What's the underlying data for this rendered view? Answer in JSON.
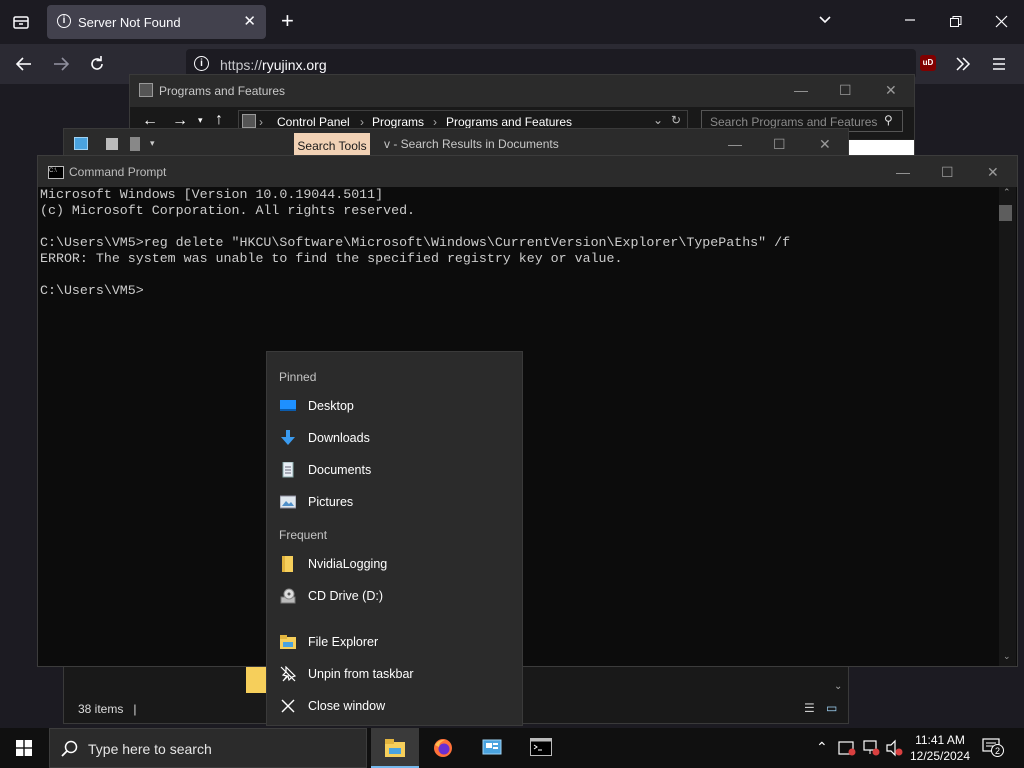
{
  "browser": {
    "tab_title": "Server Not Found",
    "url_prefix": "https://",
    "url_domain": "ryujinx.org",
    "ublock_badge": "uD"
  },
  "programs_window": {
    "title": "Programs and Features",
    "breadcrumb": [
      "Control Panel",
      "Programs",
      "Programs and Features"
    ],
    "search_placeholder": "Search Programs and Features"
  },
  "explorer_window": {
    "search_tools_tab": "Search Tools",
    "title": "v - Search Results in Documents",
    "status_count": "38 items"
  },
  "cmd": {
    "title": "Command Prompt",
    "lines": [
      "Microsoft Windows [Version 10.0.19044.5011]",
      "(c) Microsoft Corporation. All rights reserved.",
      "",
      "C:\\Users\\VM5>reg delete \"HKCU\\Software\\Microsoft\\Windows\\CurrentVersion\\Explorer\\TypePaths\" /f",
      "ERROR: The system was unable to find the specified registry key or value.",
      "",
      "C:\\Users\\VM5>"
    ]
  },
  "jumplist": {
    "pinned_header": "Pinned",
    "pinned": [
      {
        "label": "Desktop",
        "icon": "desktop-icon"
      },
      {
        "label": "Downloads",
        "icon": "downloads-icon"
      },
      {
        "label": "Documents",
        "icon": "documents-icon"
      },
      {
        "label": "Pictures",
        "icon": "pictures-icon"
      }
    ],
    "frequent_header": "Frequent",
    "frequent": [
      {
        "label": "NvidiaLogging",
        "icon": "folder-icon"
      },
      {
        "label": "CD Drive (D:)",
        "icon": "cd-drive-icon"
      }
    ],
    "actions": [
      {
        "label": "File Explorer",
        "icon": "file-explorer-icon"
      },
      {
        "label": "Unpin from taskbar",
        "icon": "unpin-icon"
      },
      {
        "label": "Close window",
        "icon": "close-icon"
      }
    ]
  },
  "taskbar": {
    "search_placeholder": "Type here to search",
    "time": "11:41 AM",
    "date": "12/25/2024",
    "notification_count": "2",
    "apps": [
      "file-explorer-icon",
      "firefox-icon",
      "control-panel-icon",
      "command-prompt-icon"
    ]
  },
  "colors": {
    "accent": "#0078d4",
    "search_tools_tab": "#f2d2b5",
    "folder_yellow": "#f6cf5b"
  }
}
